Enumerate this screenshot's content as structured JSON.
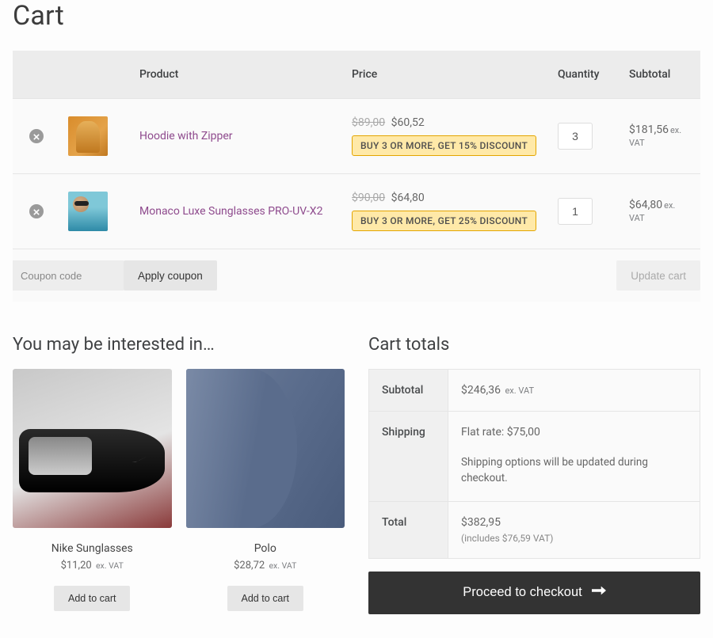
{
  "page_title": "Cart",
  "table": {
    "headers": {
      "product": "Product",
      "price": "Price",
      "quantity": "Quantity",
      "subtotal": "Subtotal"
    },
    "ex_vat_label": "ex. VAT",
    "items": [
      {
        "name": "Hoodie with Zipper",
        "old_price": "$89,00",
        "new_price": "$60,52",
        "promo": "BUY 3 OR MORE, GET 15% DISCOUNT",
        "qty": "3",
        "subtotal": "$181,56"
      },
      {
        "name": "Monaco Luxe Sunglasses PRO-UV-X2",
        "old_price": "$90,00",
        "new_price": "$64,80",
        "promo": "BUY 3 OR MORE, GET 25% DISCOUNT",
        "qty": "1",
        "subtotal": "$64,80"
      }
    ]
  },
  "coupon": {
    "placeholder": "Coupon code",
    "apply_label": "Apply coupon"
  },
  "update_cart_label": "Update cart",
  "interest": {
    "heading": "You may be interested in…",
    "add_to_cart_label": "Add to cart",
    "items": [
      {
        "name": "Nike Sunglasses",
        "price": "$11,20"
      },
      {
        "name": "Polo",
        "price": "$28,72"
      }
    ]
  },
  "totals": {
    "heading": "Cart totals",
    "rows": {
      "subtotal_label": "Subtotal",
      "subtotal_value": "$246,36",
      "shipping_label": "Shipping",
      "shipping_value": "Flat rate: $75,00",
      "shipping_note": "Shipping options will be updated during checkout.",
      "total_label": "Total",
      "total_value": "$382,95",
      "total_includes": "(includes $76,59 VAT)"
    },
    "checkout_label": "Proceed to checkout"
  }
}
